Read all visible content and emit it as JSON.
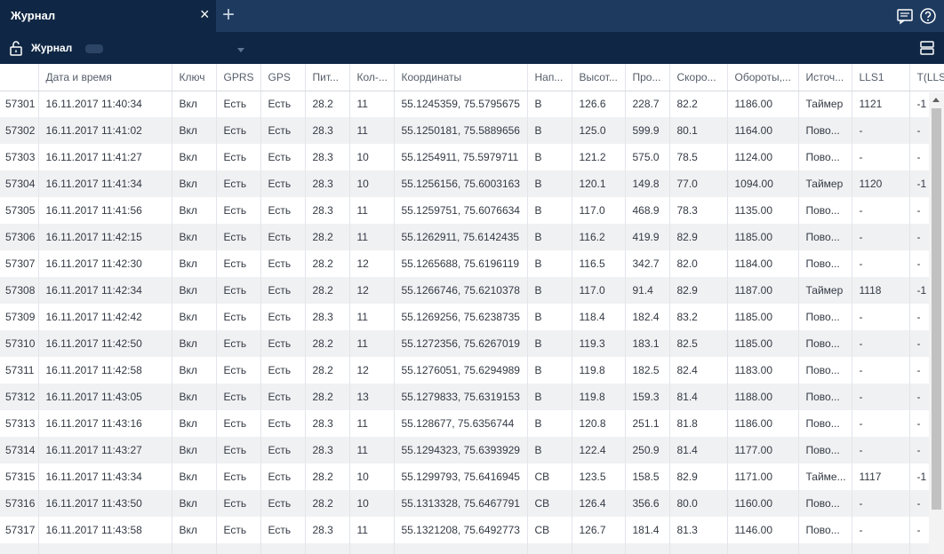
{
  "tab": {
    "title": "Журнал",
    "close": "×",
    "add": "+"
  },
  "toolbar": {
    "label": "Журнал",
    "icons": [
      "lock-icon",
      "chat-icon",
      "help-icon",
      "layout-icon"
    ]
  },
  "columns": [
    "",
    "Дата и время",
    "Ключ",
    "GPRS",
    "GPS",
    "Пит...",
    "Кол-...",
    "Координаты",
    "Нап...",
    "Высот...",
    "Про...",
    "Скоро...",
    "Обороты,...",
    "Источ...",
    "LLS1",
    "T(LLS"
  ],
  "rows": [
    [
      "57301",
      "16.11.2017 11:40:34",
      "Вкл",
      "Есть",
      "Есть",
      "28.2",
      "11",
      "55.1245359, 75.5795675",
      "В",
      "126.6",
      "228.7",
      "82.2",
      "1186.00",
      "Таймер",
      "1121",
      "-1"
    ],
    [
      "57302",
      "16.11.2017 11:41:02",
      "Вкл",
      "Есть",
      "Есть",
      "28.3",
      "11",
      "55.1250181, 75.5889656",
      "В",
      "125.0",
      "599.9",
      "80.1",
      "1164.00",
      "Пово...",
      "-",
      "-"
    ],
    [
      "57303",
      "16.11.2017 11:41:27",
      "Вкл",
      "Есть",
      "Есть",
      "28.3",
      "10",
      "55.1254911, 75.5979711",
      "В",
      "121.2",
      "575.0",
      "78.5",
      "1124.00",
      "Пово...",
      "-",
      "-"
    ],
    [
      "57304",
      "16.11.2017 11:41:34",
      "Вкл",
      "Есть",
      "Есть",
      "28.3",
      "10",
      "55.1256156, 75.6003163",
      "В",
      "120.1",
      "149.8",
      "77.0",
      "1094.00",
      "Таймер",
      "1120",
      "-1"
    ],
    [
      "57305",
      "16.11.2017 11:41:56",
      "Вкл",
      "Есть",
      "Есть",
      "28.3",
      "11",
      "55.1259751, 75.6076634",
      "В",
      "117.0",
      "468.9",
      "78.3",
      "1135.00",
      "Пово...",
      "-",
      "-"
    ],
    [
      "57306",
      "16.11.2017 11:42:15",
      "Вкл",
      "Есть",
      "Есть",
      "28.2",
      "11",
      "55.1262911, 75.6142435",
      "В",
      "116.2",
      "419.9",
      "82.9",
      "1185.00",
      "Пово...",
      "-",
      "-"
    ],
    [
      "57307",
      "16.11.2017 11:42:30",
      "Вкл",
      "Есть",
      "Есть",
      "28.2",
      "12",
      "55.1265688, 75.6196119",
      "В",
      "116.5",
      "342.7",
      "82.0",
      "1184.00",
      "Пово...",
      "-",
      "-"
    ],
    [
      "57308",
      "16.11.2017 11:42:34",
      "Вкл",
      "Есть",
      "Есть",
      "28.2",
      "12",
      "55.1266746, 75.6210378",
      "В",
      "117.0",
      "91.4",
      "82.9",
      "1187.00",
      "Таймер",
      "1118",
      "-1"
    ],
    [
      "57309",
      "16.11.2017 11:42:42",
      "Вкл",
      "Есть",
      "Есть",
      "28.3",
      "11",
      "55.1269256, 75.6238735",
      "В",
      "118.4",
      "182.4",
      "83.2",
      "1185.00",
      "Пово...",
      "-",
      "-"
    ],
    [
      "57310",
      "16.11.2017 11:42:50",
      "Вкл",
      "Есть",
      "Есть",
      "28.2",
      "11",
      "55.1272356, 75.6267019",
      "В",
      "119.3",
      "183.1",
      "82.5",
      "1185.00",
      "Пово...",
      "-",
      "-"
    ],
    [
      "57311",
      "16.11.2017 11:42:58",
      "Вкл",
      "Есть",
      "Есть",
      "28.2",
      "12",
      "55.1276051, 75.6294989",
      "В",
      "119.8",
      "182.5",
      "82.4",
      "1183.00",
      "Пово...",
      "-",
      "-"
    ],
    [
      "57312",
      "16.11.2017 11:43:05",
      "Вкл",
      "Есть",
      "Есть",
      "28.2",
      "13",
      "55.1279833, 75.6319153",
      "В",
      "119.8",
      "159.3",
      "81.4",
      "1188.00",
      "Пово...",
      "-",
      "-"
    ],
    [
      "57313",
      "16.11.2017 11:43:16",
      "Вкл",
      "Есть",
      "Есть",
      "28.3",
      "11",
      "55.128677, 75.6356744",
      "В",
      "120.8",
      "251.1",
      "81.8",
      "1186.00",
      "Пово...",
      "-",
      "-"
    ],
    [
      "57314",
      "16.11.2017 11:43:27",
      "Вкл",
      "Есть",
      "Есть",
      "28.3",
      "11",
      "55.1294323, 75.6393929",
      "В",
      "122.4",
      "250.9",
      "81.4",
      "1177.00",
      "Пово...",
      "-",
      "-"
    ],
    [
      "57315",
      "16.11.2017 11:43:34",
      "Вкл",
      "Есть",
      "Есть",
      "28.2",
      "10",
      "55.1299793, 75.6416945",
      "СВ",
      "123.5",
      "158.5",
      "82.9",
      "1171.00",
      "Тайме...",
      "1117",
      "-1"
    ],
    [
      "57316",
      "16.11.2017 11:43:50",
      "Вкл",
      "Есть",
      "Есть",
      "28.2",
      "10",
      "55.1313328, 75.6467791",
      "СВ",
      "126.4",
      "356.6",
      "80.0",
      "1160.00",
      "Пово...",
      "-",
      "-"
    ],
    [
      "57317",
      "16.11.2017 11:43:58",
      "Вкл",
      "Есть",
      "Есть",
      "28.3",
      "11",
      "55.1321208, 75.6492773",
      "СВ",
      "126.7",
      "181.4",
      "81.3",
      "1146.00",
      "Пово...",
      "-",
      "-"
    ],
    [
      "",
      "",
      "",
      "",
      "",
      "",
      "",
      "",
      "",
      "",
      "",
      "",
      "",
      "",
      "",
      ""
    ]
  ],
  "colors": {
    "tabbar": "#1e3a5f",
    "toolbar": "#0f2744",
    "row_alt": "#f0f1f3"
  }
}
